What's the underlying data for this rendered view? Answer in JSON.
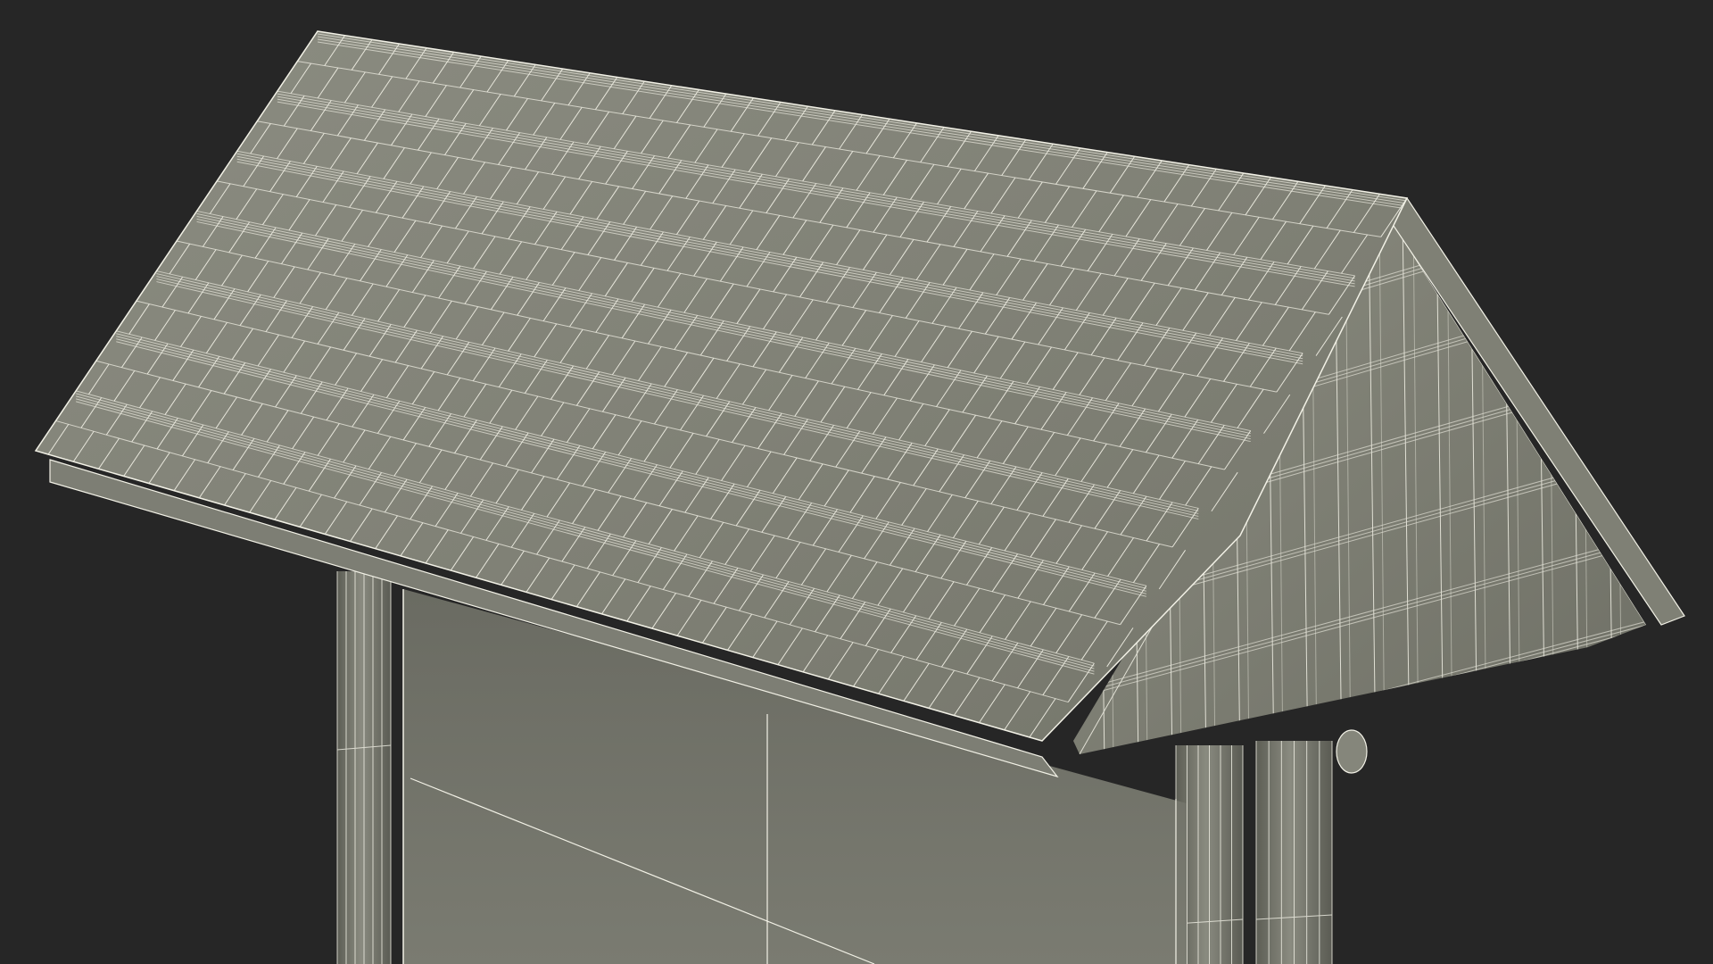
{
  "scene": {
    "subject": "wireframe-render-of-shingle-roof-sign",
    "colors": {
      "background": "#262626",
      "surface_light": "#8a8b80",
      "surface_mid": "#76776c",
      "surface_dark": "#5e5f56",
      "wire": "#f2f1e6",
      "shadow": "#4a4b44"
    }
  }
}
